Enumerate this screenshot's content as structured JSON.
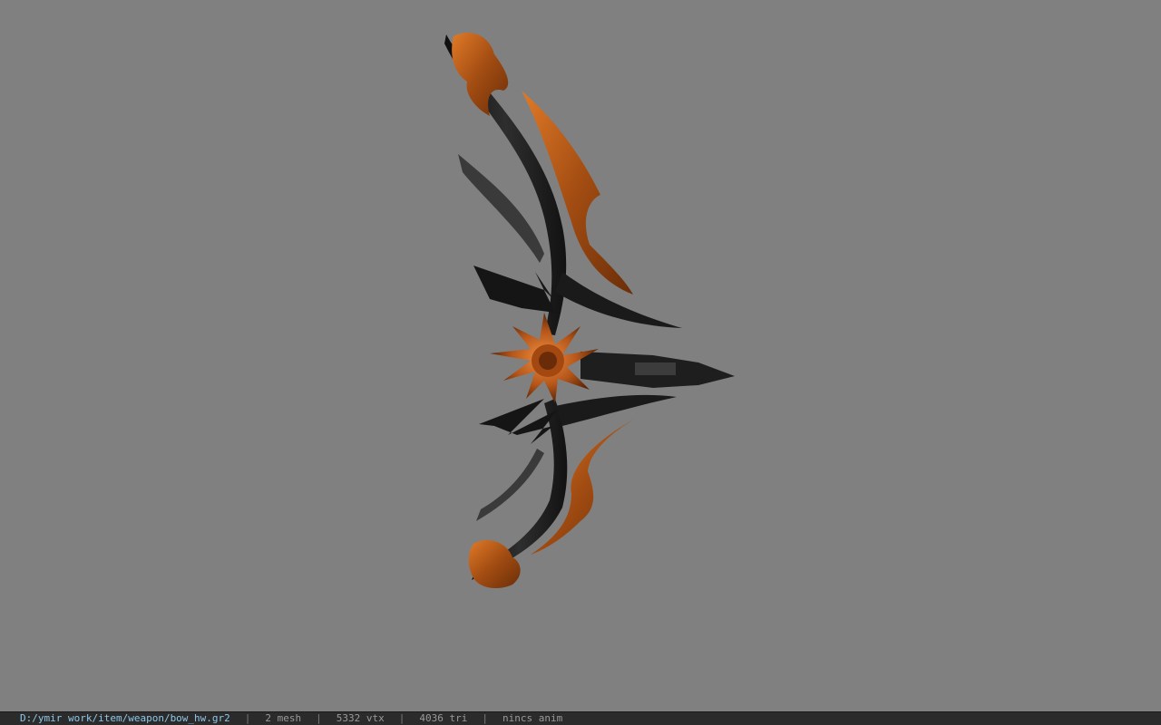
{
  "viewport": {
    "background": "#808080",
    "model": "bow-3d-model"
  },
  "status_bar": {
    "file_path": "D:/ymir work/item/weapon/bow_hw.gr2",
    "separator": "|",
    "mesh_count": "2 mesh",
    "vertex_count": "5332 vtx",
    "triangle_count": "4036 tri",
    "anim_status": "nincs anim"
  },
  "colors": {
    "status_bg": "#2b2b2b",
    "path_text": "#8fc7e8",
    "stat_text": "#9a9a9a",
    "bow_dark": "#1c1c1c",
    "bow_orange": "#c2601a"
  }
}
